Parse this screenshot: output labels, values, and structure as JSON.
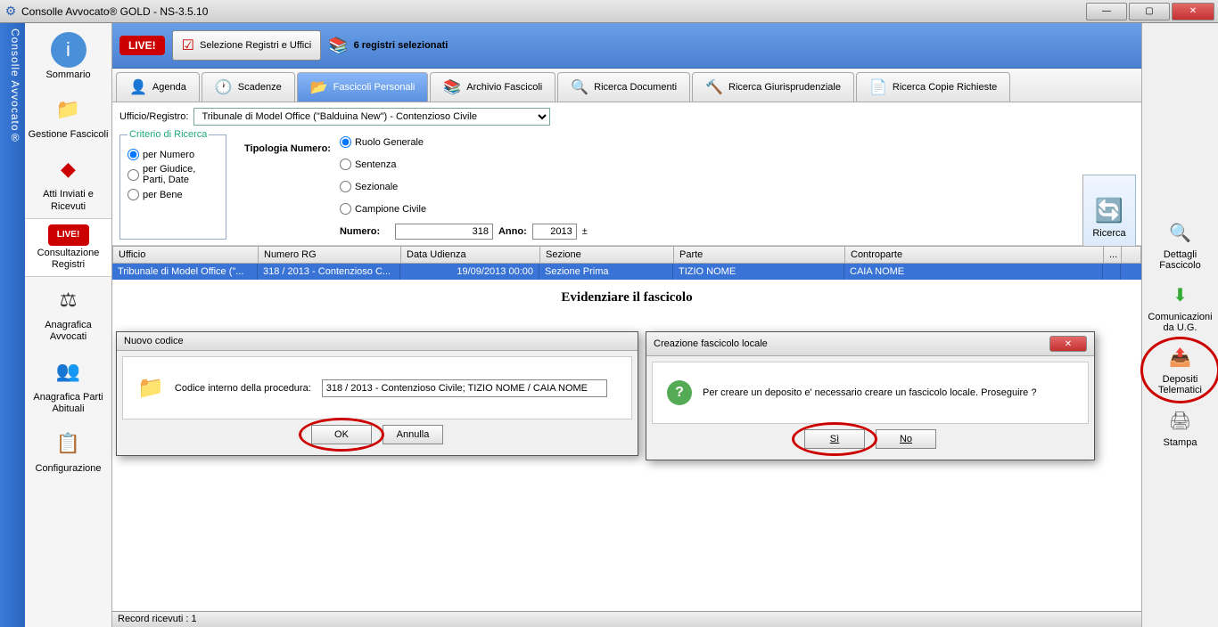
{
  "titlebar": {
    "title": "Consolle Avvocato® GOLD - NS-3.5.10"
  },
  "left_rail": "Consolle Avvocato®",
  "nav": {
    "sommario": "Sommario",
    "gestione": "Gestione Fascicoli",
    "atti": "Atti Inviati e Ricevuti",
    "consultazione": "Consultazione Registri",
    "anag_avv": "Anagrafica Avvocati",
    "anag_parti": "Anagrafica Parti Abituali",
    "config": "Configurazione",
    "live": "LIVE!"
  },
  "top": {
    "live": "LIVE!",
    "selezione": "Selezione Registri e Uffici",
    "registri": "6 registri selezionati"
  },
  "tabs": {
    "agenda": "Agenda",
    "scadenze": "Scadenze",
    "fascicoli": "Fascicoli Personali",
    "archivio": "Archivio Fascicoli",
    "ricerca_doc": "Ricerca Documenti",
    "ricerca_giur": "Ricerca Giurisprudenziale",
    "ricerca_copie": "Ricerca Copie Richieste"
  },
  "filter": {
    "ufficio_label": "Ufficio/Registro:",
    "ufficio_value": "Tribunale di Model Office (\"Balduina New\") - Contenzioso Civile",
    "criterio_legend": "Criterio di Ricerca",
    "per_numero": "per Numero",
    "per_giudice": "per Giudice, Parti, Date",
    "per_bene": "per Bene",
    "tipologia_label": "Tipologia Numero:",
    "ruolo": "Ruolo Generale",
    "sentenza": "Sentenza",
    "sezionale": "Sezionale",
    "campione": "Campione Civile",
    "numero_label": "Numero:",
    "numero_value": "318",
    "anno_label": "Anno:",
    "anno_value": "2013"
  },
  "ricerca": "Ricerca",
  "table": {
    "headers": {
      "ufficio": "Ufficio",
      "numero": "Numero RG",
      "data": "Data Udienza",
      "sezione": "Sezione",
      "parte": "Parte",
      "contro": "Controparte",
      "dots": "..."
    },
    "row": {
      "ufficio": "Tribunale di Model Office (\"...",
      "numero": "318 / 2013 - Contenzioso C...",
      "data": "19/09/2013 00:00",
      "sezione": "Sezione Prima",
      "parte": "TIZIO NOME",
      "contro": "CAIA NOME"
    },
    "evidenziare": "Evidenziare il fascicolo",
    "status": "Record ricevuti : 1"
  },
  "right": {
    "dettagli": "Dettagli Fascicolo",
    "comunicazioni": "Comunicazioni da U.G.",
    "depositi": "Depositi Telematici",
    "stampa": "Stampa"
  },
  "dialog1": {
    "title": "Nuovo codice",
    "label": "Codice interno della procedura:",
    "value": "318 / 2013 - Contenzioso Civile; TIZIO NOME / CAIA NOME",
    "ok": "OK",
    "annulla": "Annulla"
  },
  "dialog2": {
    "title": "Creazione fascicolo locale",
    "msg": "Per creare un deposito e' necessario creare un fascicolo locale. Proseguire ?",
    "si": "Sì",
    "no": "No"
  }
}
